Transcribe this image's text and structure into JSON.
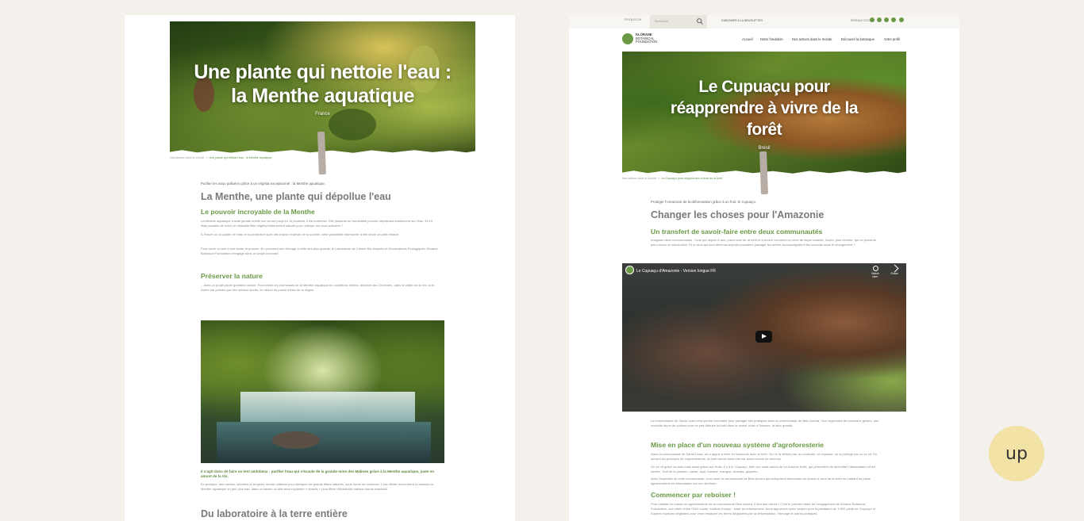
{
  "left": {
    "hero": {
      "title_line1": "Une plante qui nettoie l'eau :",
      "title_line2": "la Menthe aquatique",
      "location": "France"
    },
    "breadcrumb": {
      "root": "Nos actions dans le monde",
      "sep": ">",
      "current": "Une plante qui nettoie l'eau : la Menthe aquatique"
    },
    "lead": "Purifier les eaux polluées grâce à un végétal exceptionnel : la Menthe aquatique.",
    "h2": "La Menthe, une plante qui dépollue l'eau",
    "section1": {
      "title": "Le pouvoir incroyable de la Menthe",
      "p1": "La Menthe aquatique n'avait jamais révélé son secret jusqu'ici, et pourtant, il est immense. Elle possède un formidable pouvoir dépolluant notamment sur l'eau. Et s'il était possible de créer un véritable filtre végétal entièrement naturel pour nettoyer les eaux polluées ?",
      "p2": "À l'heure où la qualité de l'eau et sa protection sont des enjeux majeurs de la société, cette possibilité représente à elle seule un petit miracle.",
      "p3": "Pour ouvrir la voie à tout tester et prouver. En poussant son élevage à celle des plus grands, le Laboratoire de Chimie Bio-Inspirée et d'Innovations Écologiques, Klorane Botanical Foundation s'engage dans un projet innovant."
    },
    "section2": {
      "title": "Préserver la nature",
      "p1": "…avec un projet pilote grandeur nature. Pour tester les promesses de la Menthe aquatique en conditions réelles, direction les Cévennes, dans la vallée de la Vis où la rivière est polluée par des métaux lourds, en raison du passé minier de la région."
    },
    "caption": "Il s'agit donc de faire un test ambitieux : purifier l'eau qui s'écoule de la grande mine des Malines grâce à la Menthe aquatique, juste en amont de la Vis.",
    "after_caption": "En pratique, des racines, séchées et broyées, seront utilisées pour fabriquer de grands filtres naturels, sous forme de colonnes. L'eau filtrée rencontrera à nouveau la Menthe aquatique un peu plus bas, dans un bassin où elle sera implantée « vivante » pour filtrer d'éventuels métaux lourds résiduels.",
    "h2_bottom": "Du laboratoire à la terre entière"
  },
  "right": {
    "topbar": {
      "lang": "FR  EN  ES  ZH",
      "search_placeholder": "Rechercher",
      "newsletter": "S'ABONNER À LA NEWSLETTER",
      "social_label": "RÉSEAUX SOCIAUX"
    },
    "logo": {
      "line1": "KLORANE",
      "line2": "BOTANICAL",
      "line3": "FOUNDATION"
    },
    "nav": [
      "Accueil",
      "Notre fondation",
      "Nos actions dans le monde",
      "Découvrir la botanique",
      "Votre profil"
    ],
    "hero": {
      "title_line1": "Le Cupuaçu pour",
      "title_line2": "réapprendre à vivre de la",
      "title_line3": "forêt",
      "location": "Brésil"
    },
    "breadcrumb": {
      "root": "Nos actions dans le monde",
      "sep": ">",
      "current": "Le Cupuaçu pour réapprendre à vivre de la forêt"
    },
    "lead": "Protéger l'Amazonie de la déforestation grâce à un fruit, le Cupuaçu.",
    "h2": "Changer les choses pour l'Amazonie",
    "section1": {
      "title": "Un transfert de savoir-faire entre deux communautés",
      "p1": "Imaginez deux communautés : l'une qui depuis 8 ans, prend soin de la forêt et a trouvé comment en vivre de façon durable, l'autre, plus récente, qui ne possède pas encore ce savoir-faire. Et si ceux qui sont devenus experts pouvaient partager les arbres accompagnaient les seconds dans le changement ?"
    },
    "video": {
      "title": "Le Cupuaçu d'Amazonie - Version longue FR",
      "watch_later": "Watch later",
      "share": "Share"
    },
    "after_video": "La communauté de Santa Luzia s'est portée volontaire pour partager ses pratiques avec la communauté de Belo Aurora : leur apprendre de nouveaux gestes, une nouvelle façon de cultiver pour ne pas détruire la forêt dans le vivant, mais à l'inverse, la faire grandir.",
    "section2": {
      "title": "Mise en place d'un nouveau système d'agroforesterie",
      "p1": "Dans la communauté de Santa Luzia, on a appris à vivre en harmonie avec la forêt. On ne la détruit pas, au contraire, on replante, on la protège par un en vit. En suivant les principes de l'agroforesterie, la forêt trouve toute elle est aussi source de revenus.",
      "p2": "On en vit grâce au bois mais aussi grâce aux fruits. Il y a le Cupuaçu, bien sûr, mais autour de lui d'autres fruits, qui permettent de diversifier l'alimentation et les ventes : fruit de la passion, cacao, açaí, banane, mangue, avocats, goyaves…",
      "p3": "Avec l'expertise de cette communauté, c'est toute la communauté de Belo Aurora qui entreprend désormais de réussir à vivre de la forêt en mettant en place agroforesterie et reforestation sur son territoire."
    },
    "section3": {
      "title": "Commencer par reboiser !",
      "p1": "Pour installer la culture en agroforesterie de la communauté Belo Aurora, il faut des arbres ! C'est le premier mixte de l'engagement de Klorane Botanical Foundation, aux côtés d'une ONG locale, Instituto Ibeaçu : aider au reboisement. Nous apportons notre soutien pour la plantation de 3 000 pieds de Cupuaçu et d'autres espèces végétales pour venir restaurer les terres dégradées par la déforestation, l'élevage et autres pratiques."
    }
  },
  "up_button": "up",
  "colors": {
    "accent_green": "#6a9a45",
    "background": "#f4f1ec",
    "up_button": "#f2e2a6"
  }
}
